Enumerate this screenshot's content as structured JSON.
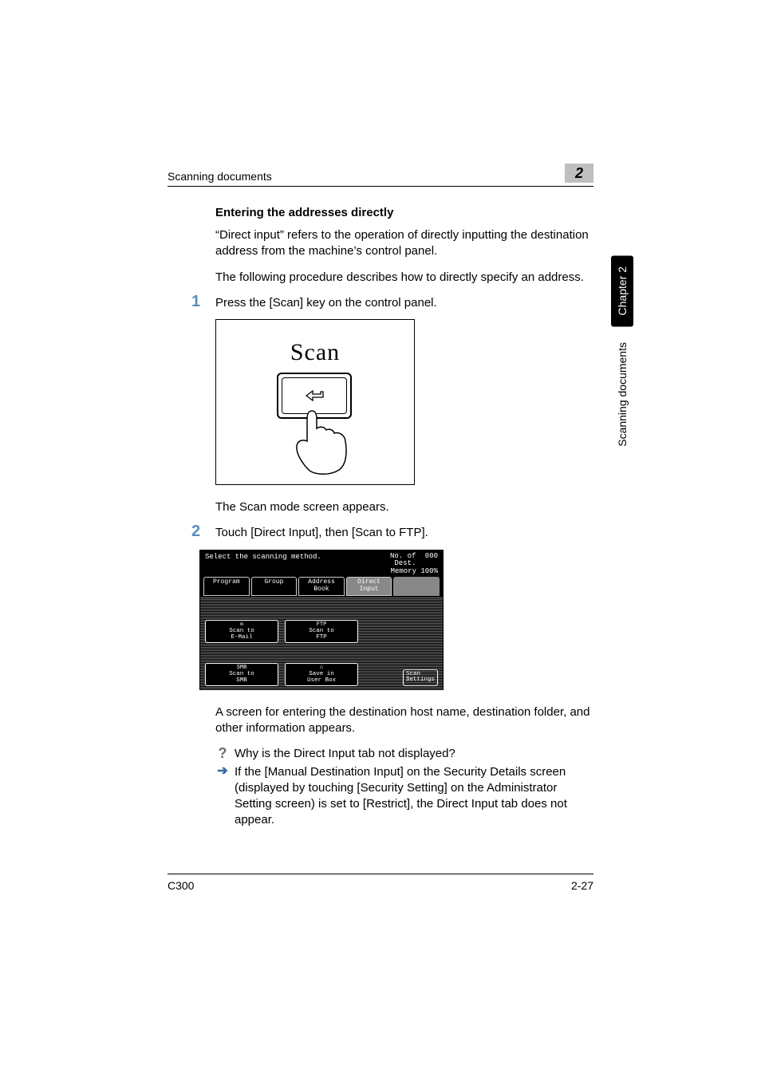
{
  "header": {
    "running": "Scanning documents",
    "chapnum": "2"
  },
  "side": {
    "chapter": "Chapter 2",
    "label": "Scanning documents"
  },
  "section": {
    "title": "Entering the addresses directly",
    "intro1": "“Direct input” refers to the operation of directly inputting the destination address from the machine’s control panel.",
    "intro2": "The following procedure describes how to directly specify an address."
  },
  "steps": {
    "s1": {
      "num": "1",
      "text": "Press the [Scan] key on the control panel.",
      "fig_label": "Scan",
      "result": "The Scan mode screen appears."
    },
    "s2": {
      "num": "2",
      "text": "Touch [Direct Input], then [Scan to FTP].",
      "screen": {
        "prompt": "Select the scanning method.",
        "dest_label": "No. of\nDest.",
        "dest_value": "000",
        "memory": "Memory 100%",
        "tabs": {
          "program": "Program",
          "group": "Group",
          "address_book": "Address\nBook",
          "direct_input": "Direct\nInput"
        },
        "buttons": {
          "email_tag": "",
          "email": "Scan to\nE-Mail",
          "ftp_tag": "FTP",
          "ftp": "Scan to\nFTP",
          "smb_tag": "SMB",
          "smb": "Scan to\nSMB",
          "userbox": "Save in\nUser Box",
          "scan_settings": "Scan\nSettings"
        }
      },
      "result": "A screen for entering the destination host name, destination folder, and other information appears.",
      "qa_q": "Why is the Direct Input tab not displayed?",
      "qa_a": "If the [Manual Destination Input] on the Security Details screen (displayed by touching [Security Setting] on the Administrator Setting screen) is set to [Restrict], the Direct Input tab does not appear."
    }
  },
  "footer": {
    "model": "C300",
    "page": "2-27"
  }
}
